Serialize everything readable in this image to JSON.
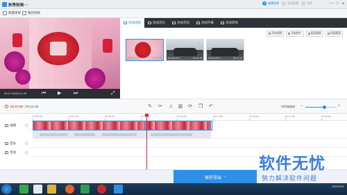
{
  "app": {
    "title": "秋秀剪辑",
    "badge": "Beta"
  },
  "steps": [
    {
      "num": "1",
      "label": "编辑视频"
    },
    {
      "num": "2",
      "label": "导出视频"
    },
    {
      "num": "3",
      "label": "完成"
    }
  ],
  "window_buttons": {
    "min": "—",
    "max": "□",
    "close": "✕"
  },
  "toolbar": {
    "new_project": "新建项目",
    "my_projects": "我的项目"
  },
  "preview": {
    "time": "00:07.96/00:12.48",
    "prev_icon": "⏮",
    "play_icon": "▶",
    "next_icon": "⏭",
    "fullscreen_icon": "⤢"
  },
  "tabs": [
    {
      "label": "添加视频"
    },
    {
      "label": "添加音乐"
    },
    {
      "label": "添加音效"
    },
    {
      "label": "添加字幕"
    },
    {
      "label": "添加转场"
    }
  ],
  "right_tools": [
    "添加视频",
    "添加图片",
    "画面截图",
    "画面截图"
  ],
  "clips": [
    {
      "name": "00093.MTS",
      "duration": "00:12.48"
    },
    {
      "name": "00138.MTS",
      "duration": "00:10.49"
    },
    {
      "name": "00136.MTS",
      "duration": "00:07.20"
    }
  ],
  "timeline": {
    "current": "00:07.96",
    "total": "/00:12.48",
    "zoom_label": "时间轴缩放：",
    "zoom_level": 0.6,
    "ticks": [
      "00:00.00",
      "00:02.50",
      "00:05.00",
      "00:07.50",
      "00:10.00",
      "00:12.50",
      "00:15.00",
      "00:17.50",
      "00:20.00"
    ]
  },
  "tracks": {
    "video": "视频",
    "music": "音乐",
    "voice": "音效"
  },
  "save": {
    "label": "保存导出",
    "arrow": "›"
  },
  "watermark": {
    "title": "软件无忧",
    "subtitle": "努力解决软件问题"
  },
  "taskbar": {
    "date": "2019/3/21",
    "time": ""
  }
}
